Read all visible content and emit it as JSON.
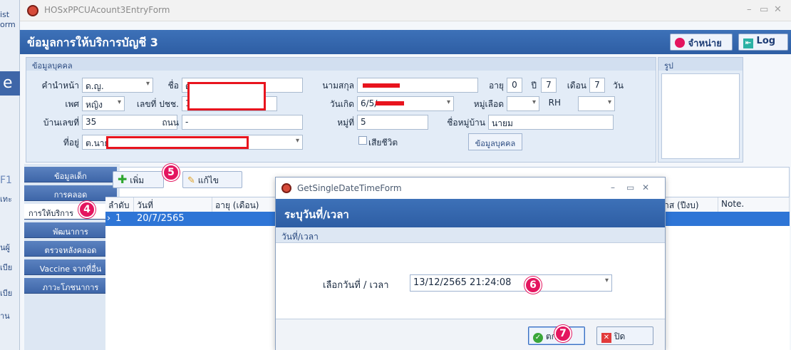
{
  "left_strip": {
    "items": [
      "ist",
      "orm",
      "e",
      "F1",
      "เทะ",
      "นผู้",
      "เบีย",
      "เบีย",
      "าน"
    ]
  },
  "window": {
    "title": "HOSxPPCUAcount3EntryForm",
    "minimize": "–",
    "maximize": "▭",
    "close": "✕"
  },
  "header": {
    "title": "ข้อมูลการให้บริการบัญชี 3",
    "discharge_label": "จำหน่าย",
    "log_label": "Log"
  },
  "personal": {
    "group_title": "ข้อมูลบุคคล",
    "prefix_label": "คำนำหน้า",
    "prefix_value": "ด.ญ.",
    "name_label": "ชื่อ",
    "name_value": "ด",
    "surname_label": "นามสกุล",
    "age_label": "อายุ",
    "age_y_value": "0",
    "age_y_unit": "ปี",
    "age_m_value": "7",
    "age_m_unit": "เดือน",
    "age_d_value": "7",
    "age_d_unit": "วัน",
    "sex_label": "เพศ",
    "sex_value": "หญิง",
    "cid_label": "เลขที่ ปชช.",
    "cid_value": "1",
    "birth_label": "วันเกิด",
    "birth_value": "6/5/",
    "blood_label": "หมู่เลือด",
    "rh_label": "RH",
    "house_label": "บ้านเลขที่",
    "house_value": "35",
    "road_label": "ถนน",
    "road_value": "-",
    "moo_label": "หมู่ที่",
    "moo_value": "5",
    "village_label": "ชื่อหมู่บ้าน",
    "village_value": "นายม",
    "address_label": "ที่อยู่",
    "address_value": "ต.นาย",
    "dead_label": "เสียชีวิต",
    "person_button": "ข้อมูลบุคคล"
  },
  "photo": {
    "title": "รูป"
  },
  "side_menu": [
    "ข้อมูลเด็ก",
    "การคลอด",
    "การให้บริการ",
    "พัฒนาการ",
    "ตรวจหลังคลอด",
    "Vaccine จากที่อื่น",
    "ภาวะโภชนาการ"
  ],
  "toolbar": {
    "add_label": "เพิ่ม",
    "edit_label": "แก้ไข"
  },
  "grid": {
    "headers": [
      "ลำดับ",
      "วันที่",
      "อายุ (เดือน)",
      "ไตรมาส (ปีงบ)",
      "Note."
    ],
    "rows": [
      {
        "no": "1",
        "date": "20/7/2565"
      }
    ]
  },
  "dialog": {
    "title": "GetSingleDateTimeForm",
    "heading": "ระบุวันที่/เวลา",
    "section": "วันที่/เวลา",
    "field_label": "เลือกวันที่ / เวลา",
    "datetime_value": "13/12/2565 21:24:08",
    "ok_label": "ตก",
    "close_label": "ปิด",
    "minimize": "–",
    "maximize": "▭",
    "close": "✕"
  },
  "steps": [
    "4",
    "5",
    "6",
    "7"
  ],
  "colors": {
    "header": "#2e5ea4",
    "selected_row": "#2e75d6",
    "badge": "#e4155f",
    "redact": "#e8141e"
  }
}
